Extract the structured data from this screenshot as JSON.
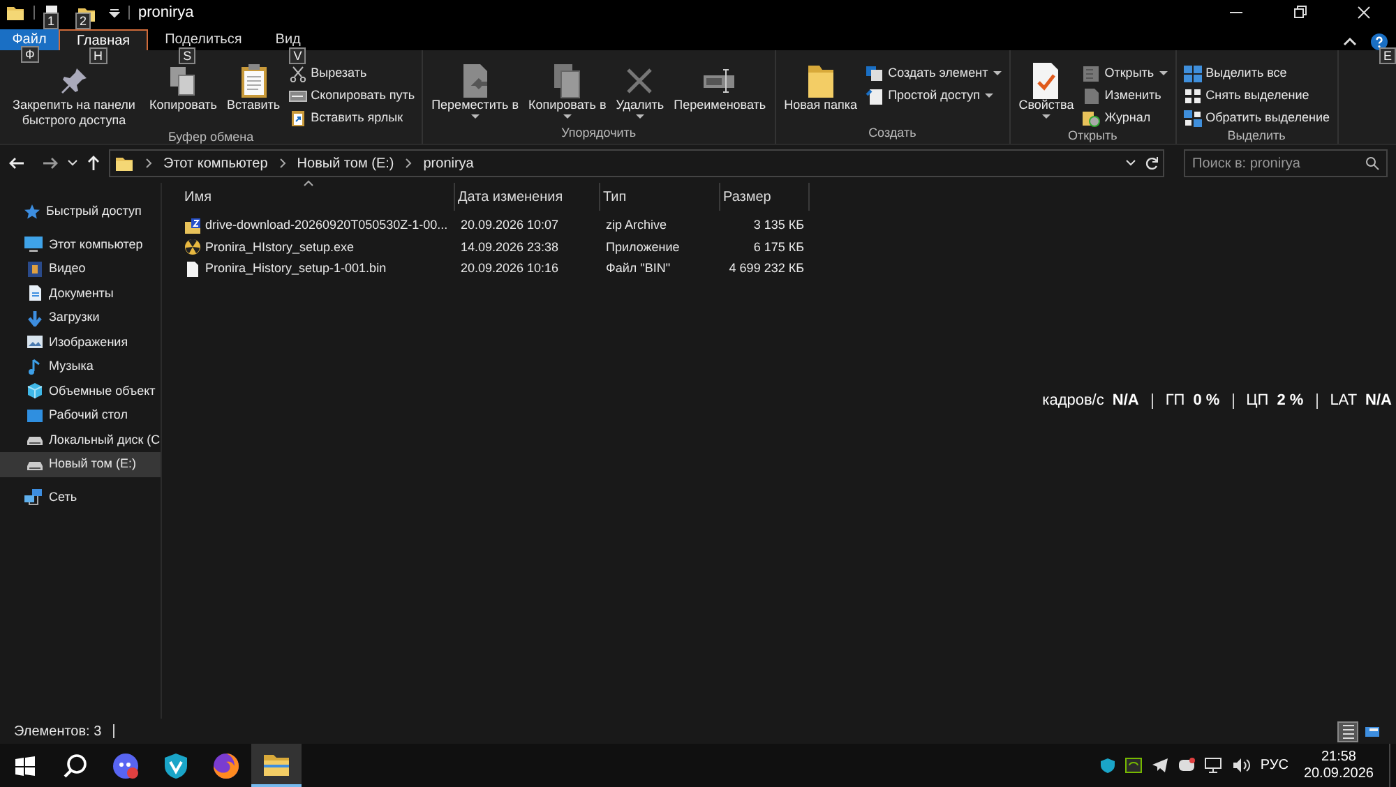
{
  "window": {
    "title": "pronirya",
    "quick_access_keytips": [
      "1",
      "2"
    ],
    "help_keytip": "E"
  },
  "tabs": [
    {
      "label": "Файл",
      "keytip": "Ф",
      "kind": "file",
      "selected": false
    },
    {
      "label": "Главная",
      "keytip": "H",
      "kind": "tab",
      "selected": true
    },
    {
      "label": "Поделиться",
      "keytip": "S",
      "kind": "tab",
      "selected": false
    },
    {
      "label": "Вид",
      "keytip": "V",
      "kind": "tab",
      "selected": false
    }
  ],
  "ribbon": [
    {
      "label": "Буфер обмена",
      "items": [
        {
          "kind": "large",
          "label": "Закрепить на панели быстрого доступа",
          "dropdown": false
        },
        {
          "kind": "large",
          "label": "Копировать",
          "dropdown": false
        },
        {
          "kind": "large",
          "label": "Вставить",
          "dropdown": false
        },
        {
          "kind": "small",
          "label": "Вырезать",
          "dropdown": false
        },
        {
          "kind": "small",
          "label": "Скопировать путь",
          "dropdown": false
        },
        {
          "kind": "small",
          "label": "Вставить ярлык",
          "dropdown": false
        }
      ]
    },
    {
      "label": "Упорядочить",
      "items": [
        {
          "kind": "large",
          "label": "Переместить в",
          "dropdown": true
        },
        {
          "kind": "large",
          "label": "Копировать в",
          "dropdown": true
        },
        {
          "kind": "large",
          "label": "Удалить",
          "dropdown": true
        },
        {
          "kind": "large",
          "label": "Переименовать",
          "dropdown": false
        }
      ]
    },
    {
      "label": "Создать",
      "items": [
        {
          "kind": "large",
          "label": "Новая папка",
          "dropdown": false
        },
        {
          "kind": "small",
          "label": "Создать элемент",
          "dropdown": true
        },
        {
          "kind": "small",
          "label": "Простой доступ",
          "dropdown": true
        }
      ]
    },
    {
      "label": "Открыть",
      "items": [
        {
          "kind": "large",
          "label": "Свойства",
          "dropdown": true
        },
        {
          "kind": "small",
          "label": "Открыть",
          "dropdown": true
        },
        {
          "kind": "small",
          "label": "Изменить",
          "dropdown": false
        },
        {
          "kind": "small",
          "label": "Журнал",
          "dropdown": false
        }
      ]
    },
    {
      "label": "Выделить",
      "items": [
        {
          "kind": "small",
          "label": "Выделить все",
          "dropdown": false
        },
        {
          "kind": "small",
          "label": "Снять выделение",
          "dropdown": false
        },
        {
          "kind": "small",
          "label": "Обратить выделение",
          "dropdown": false
        }
      ]
    }
  ],
  "address": {
    "path": [
      "Этот компьютер",
      "Новый том (E:)",
      "pronirya"
    ],
    "search_placeholder": "Поиск в: pronirya"
  },
  "nav": [
    {
      "label": "Быстрый доступ",
      "kind": "star",
      "selected": false
    },
    {
      "label": "Этот компьютер",
      "kind": "pc",
      "selected": false,
      "children": [
        {
          "label": "Видео",
          "kind": "video",
          "selected": false
        },
        {
          "label": "Документы",
          "kind": "docs",
          "selected": false
        },
        {
          "label": "Загрузки",
          "kind": "down",
          "selected": false
        },
        {
          "label": "Изображения",
          "kind": "pics",
          "selected": false
        },
        {
          "label": "Музыка",
          "kind": "music",
          "selected": false
        },
        {
          "label": "Объемные объект",
          "kind": "cube",
          "selected": false
        },
        {
          "label": "Рабочий стол",
          "kind": "desk",
          "selected": false
        },
        {
          "label": "Локальный диск (C",
          "kind": "drive",
          "selected": false
        },
        {
          "label": "Новый том (E:)",
          "kind": "drive",
          "selected": true
        }
      ]
    },
    {
      "label": "Сеть",
      "kind": "net",
      "selected": false
    }
  ],
  "table": {
    "columns": [
      "Имя",
      "Дата изменения",
      "Тип",
      "Размер"
    ],
    "rows": [
      {
        "kind": "zip",
        "name": "drive-download-20260920T050530Z-1-00...",
        "date": "20.09.2026 10:07",
        "type": "zip Archive",
        "size": "3 135 КБ"
      },
      {
        "kind": "exe",
        "name": "Pronira_HIstory_setup.exe",
        "date": "14.09.2026 23:38",
        "type": "Приложение",
        "size": "6 175 КБ"
      },
      {
        "kind": "file",
        "name": "Pronira_History_setup-1-001.bin",
        "date": "20.09.2026 10:16",
        "type": "Файл \"BIN\"",
        "size": "4 699 232 КБ"
      }
    ]
  },
  "overlay": [
    {
      "label": "кадров/с",
      "value": "N/A"
    },
    {
      "label": "ГП",
      "value": "0 %"
    },
    {
      "label": "ЦП",
      "value": "2 %"
    },
    {
      "label": "LAT",
      "value": "N/A"
    }
  ],
  "status_bar": {
    "text": "Элементов: 3",
    "views": [
      {
        "kind": "details",
        "selected": true
      },
      {
        "kind": "tiles",
        "selected": false
      }
    ]
  },
  "taskbar": {
    "apps": [
      {
        "kind": "chat",
        "selected": false
      },
      {
        "kind": "shield",
        "selected": false
      },
      {
        "kind": "browser",
        "selected": false
      },
      {
        "kind": "folder",
        "selected": true
      }
    ],
    "language": "РУС",
    "time": "21:58",
    "date": "20.09.2026"
  }
}
